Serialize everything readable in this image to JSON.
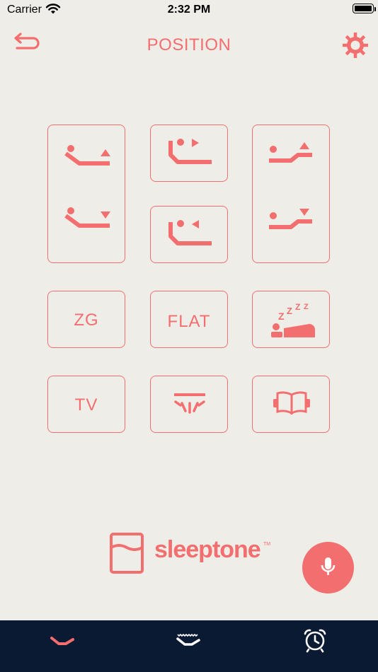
{
  "status_bar": {
    "carrier": "Carrier",
    "time": "2:32 PM"
  },
  "header": {
    "title": "POSITION"
  },
  "presets": {
    "zg_label": "ZG",
    "flat_label": "FLAT",
    "tv_label": "TV"
  },
  "brand": {
    "name": "sleeptone",
    "trademark": "TM"
  },
  "colors": {
    "accent": "#f36e6e",
    "background": "#eeede8",
    "tabbar": "#0b1a33"
  },
  "icons": {
    "back": "undo-arrow-icon",
    "settings": "gear-icon",
    "mic": "microphone-icon",
    "tabs": [
      "bed-position-icon",
      "massage-icon",
      "alarm-clock-icon"
    ]
  },
  "tabs": {
    "active_index": 0
  }
}
